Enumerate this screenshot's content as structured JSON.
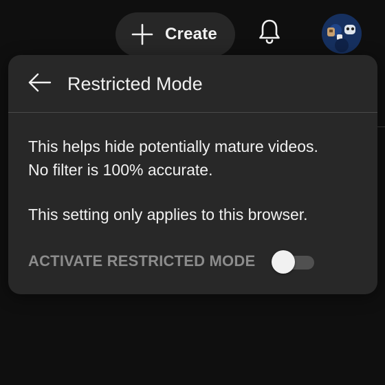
{
  "header": {
    "create_label": "Create",
    "plus_icon": "plus-icon",
    "bell_icon": "bell-icon",
    "avatar_icon": "avatar"
  },
  "popup": {
    "title": "Restricted Mode",
    "back_icon": "back-arrow-icon",
    "description_line1": "This helps hide potentially mature videos.",
    "description_line2": "No filter is 100% accurate.",
    "note": "This setting only applies to this browser.",
    "activate_label": "ACTIVATE RESTRICTED MODE",
    "toggle_on": false
  },
  "colors": {
    "background": "#0f0f0f",
    "popup_bg": "#282828",
    "button_bg": "#272727",
    "text": "#f1f1f1",
    "muted_text": "#8c8c8c",
    "toggle_track": "#505050"
  }
}
